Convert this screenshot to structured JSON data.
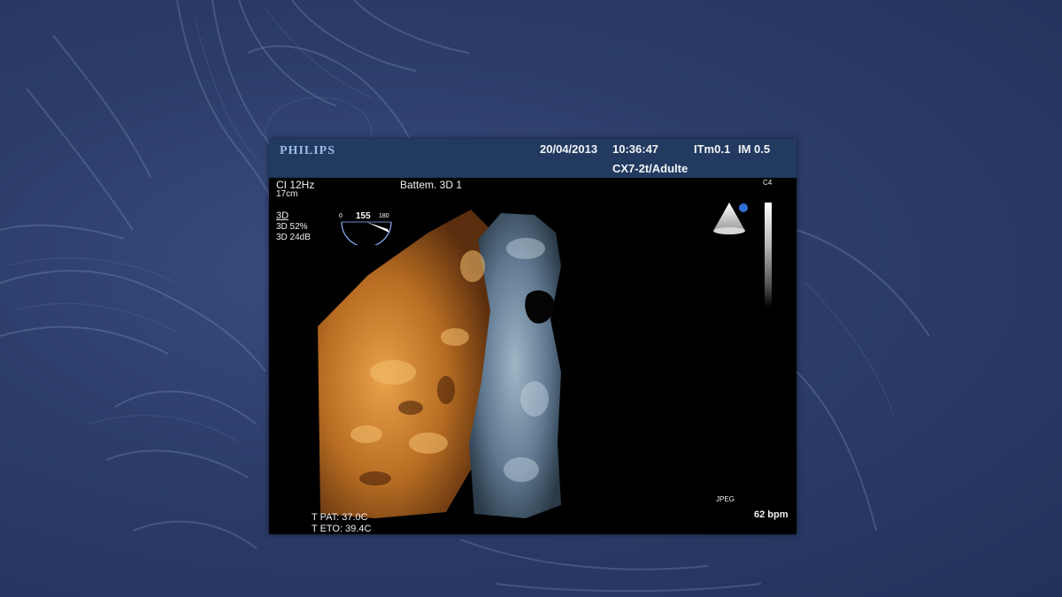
{
  "header": {
    "brand": "PHILIPS",
    "date": "20/04/2013",
    "time": "10:36:47",
    "itm": "ITm0.1",
    "im": "IM 0.5",
    "probe": "CX7-2t/Adulte"
  },
  "overlay": {
    "ci": "CI 12Hz",
    "depth": "17cm",
    "mode": "3D",
    "gain1": "3D 52%",
    "gain2": "3D 24dB",
    "preset": "Battem. 3D 1",
    "angle_min": "0",
    "angle_value": "155",
    "angle_max": "180",
    "grayscale_label": "C4",
    "format": "JPEG",
    "heart_rate": "62 bpm",
    "temp_patient": "T PAT: 37.0C",
    "temp_probe": "T ETO: 39.4C"
  },
  "colors": {
    "background": "#2c3d6a",
    "header_bar": "#223a60",
    "brand_text": "#9bbbe6",
    "tissue_orange": "#c8822e",
    "tissue_blue": "#6f8aa0",
    "probe_dot": "#2f6fd6"
  },
  "icons": {
    "probe_orientation": "probe-sector-icon",
    "angle_gauge": "angle-gauge-icon"
  }
}
